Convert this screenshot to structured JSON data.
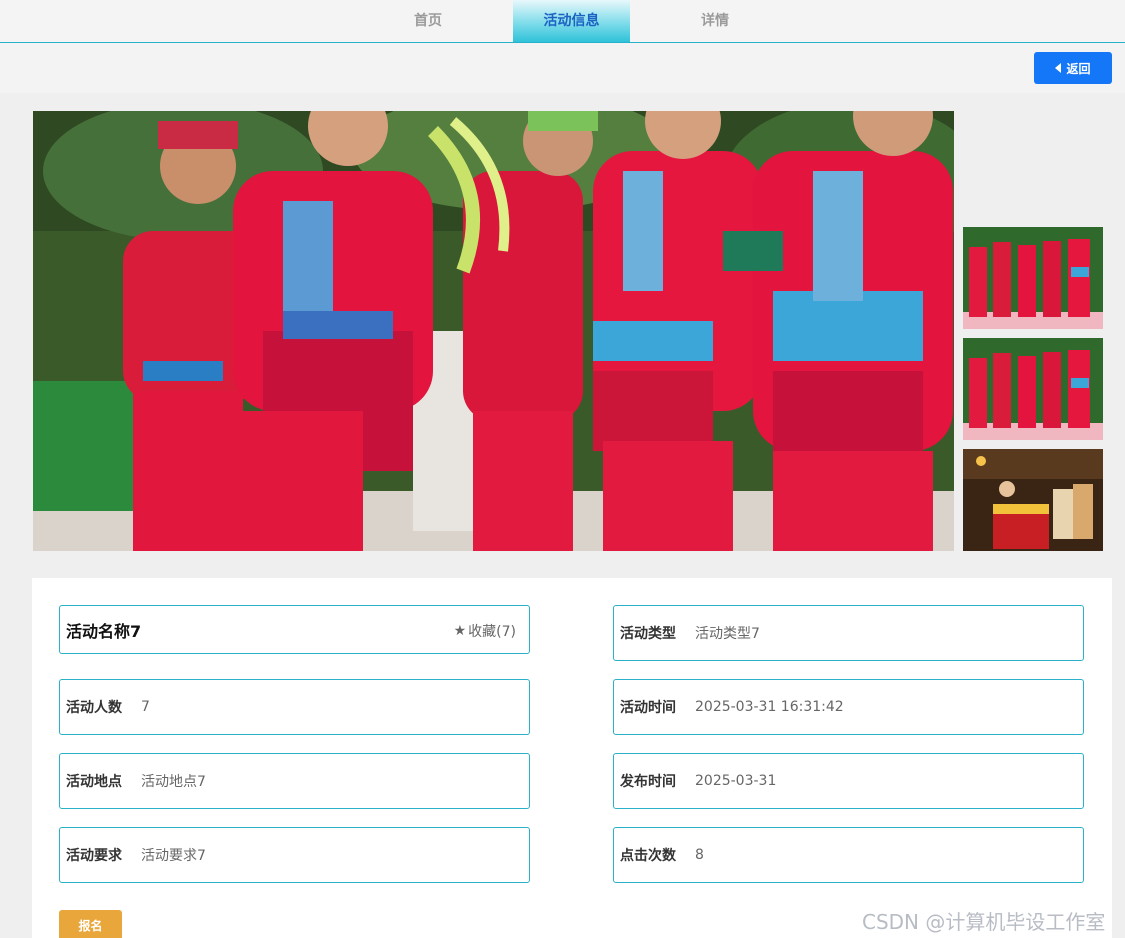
{
  "nav": {
    "tabs": [
      {
        "label": "首页"
      },
      {
        "label": "活动信息"
      },
      {
        "label": "详情"
      }
    ],
    "active": "活动信息"
  },
  "toolbar": {
    "back_label": "返回"
  },
  "gallery": {
    "main_image": "ethnic-dance-photo",
    "thumbnails": [
      "dance-troupe-photo",
      "dance-troupe-photo",
      "evening-performance-photo"
    ]
  },
  "activity": {
    "name": "活动名称7",
    "favorite_label": "收藏(7)",
    "fields": [
      {
        "label": "活动类型",
        "value": "活动类型7"
      },
      {
        "label": "活动人数",
        "value": "7"
      },
      {
        "label": "活动时间",
        "value": "2025-03-31 16:31:42"
      },
      {
        "label": "活动地点",
        "value": "活动地点7"
      },
      {
        "label": "发布时间",
        "value": "2025-03-31"
      },
      {
        "label": "活动要求",
        "value": "活动要求7"
      },
      {
        "label": "点击次数",
        "value": "8"
      }
    ]
  },
  "signup_label": "报名",
  "watermark": "CSDN @计算机毕设工作室",
  "colors": {
    "accent": "#27b2c9",
    "primary_button": "#1477f8",
    "signup_button": "#e9a63b"
  }
}
